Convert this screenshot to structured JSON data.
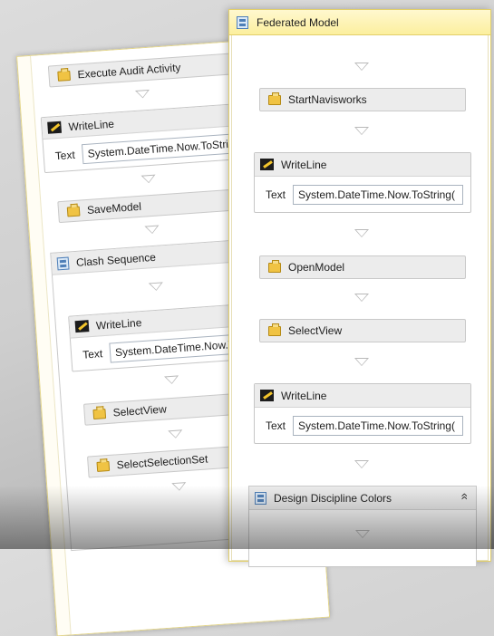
{
  "back_panel": {
    "items": [
      {
        "type": "activity",
        "label": "Execute Audit Activity",
        "icon": "box-icon"
      },
      {
        "type": "writeline",
        "label": "WriteLine",
        "text_label": "Text",
        "text_value": "System.DateTime.Now.ToString()",
        "icon": "writeline-icon"
      },
      {
        "type": "activity",
        "label": "SaveModel",
        "icon": "box-icon"
      },
      {
        "type": "sequence",
        "label": "Clash Sequence",
        "icon": "sequence-icon"
      },
      {
        "type": "writeline",
        "label": "WriteLine",
        "text_label": "Text",
        "text_value": "System.DateTime.Now.ToS",
        "icon": "writeline-icon"
      },
      {
        "type": "activity",
        "label": "SelectView",
        "icon": "box-icon"
      },
      {
        "type": "activity",
        "label": "SelectSelectionSet",
        "icon": "box-icon"
      }
    ]
  },
  "front_panel": {
    "title": "Federated Model",
    "title_icon": "sequence-icon",
    "items": [
      {
        "type": "activity",
        "label": "StartNavisworks",
        "icon": "box-icon"
      },
      {
        "type": "writeline",
        "label": "WriteLine",
        "text_label": "Text",
        "text_value": "System.DateTime.Now.ToString(",
        "icon": "writeline-icon"
      },
      {
        "type": "activity",
        "label": "OpenModel",
        "icon": "box-icon"
      },
      {
        "type": "activity",
        "label": "SelectView",
        "icon": "box-icon"
      },
      {
        "type": "writeline",
        "label": "WriteLine",
        "text_label": "Text",
        "text_value": "System.DateTime.Now.ToString(",
        "icon": "writeline-icon"
      },
      {
        "type": "sequence",
        "label": "Design Discipline Colors",
        "icon": "sequence-icon",
        "collapse_icon": "double-chevron-up-icon",
        "collapse_glyph": "»"
      }
    ]
  },
  "colors": {
    "header_accent": "#fcef9e",
    "border_accent": "#e2cf6a",
    "activity_bg": "#ececec",
    "folder_icon": "#f0c343"
  }
}
